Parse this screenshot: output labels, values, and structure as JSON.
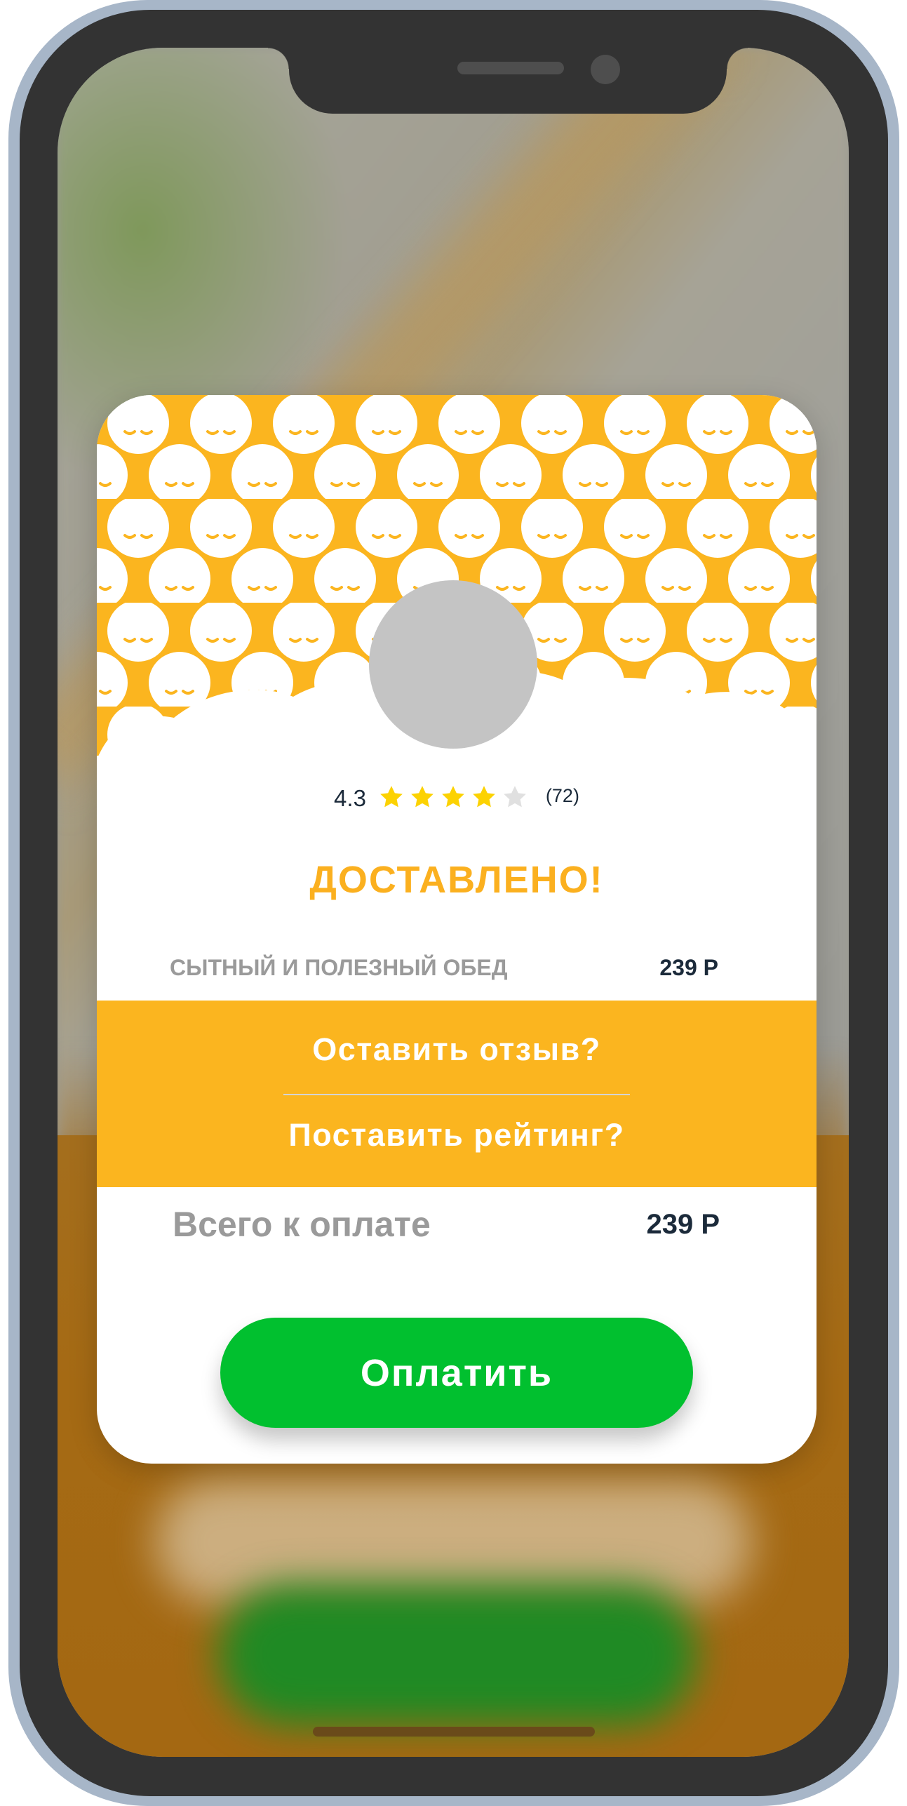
{
  "colors": {
    "accent_yellow": "#fbb51f",
    "title_yellow": "#fbb01f",
    "pay_green": "#01c02f",
    "star_filled": "#fcd202",
    "star_empty": "#e0e0e0",
    "text_dark": "#1b2a3a",
    "text_muted": "#9a9a9a"
  },
  "restaurant": {
    "rating": "4.3",
    "stars_filled": 4,
    "stars_total": 5,
    "review_count": "(72)"
  },
  "status": {
    "title": "ДОСТАВЛЕНО!"
  },
  "order": {
    "item_name": "СЫТНЫЙ И ПОЛЕЗНЫЙ ОБЕД",
    "item_price": "239 Р"
  },
  "actions": {
    "review_label": "Оставить отзыв?",
    "rate_label": "Поставить рейтинг?"
  },
  "total": {
    "label": "Всего к оплате",
    "price": "239 Р"
  },
  "pay_button": {
    "label": "Оплатить"
  }
}
